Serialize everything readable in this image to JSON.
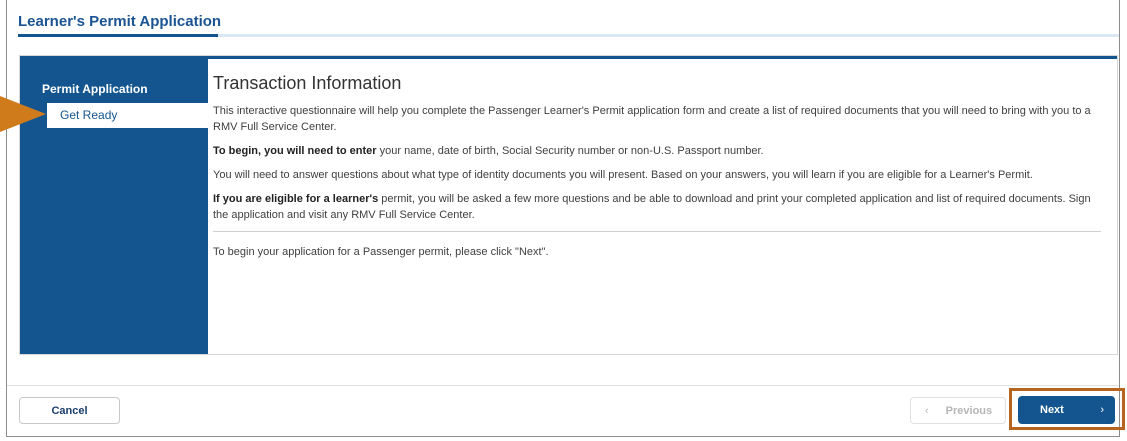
{
  "app": {
    "title": "Learner's Permit Application"
  },
  "sidebar": {
    "heading": "Permit Application",
    "items": [
      {
        "label": "Get Ready",
        "active": true
      }
    ]
  },
  "main": {
    "heading": "Transaction Information",
    "p1": "This interactive questionnaire will help you complete the Passenger Learner's Permit application form and create a list of required documents that you will need to bring with you to a RMV Full Service Center.",
    "p2_bold": "To begin, you will need to enter",
    "p2_rest": " your name, date of birth, Social Security number or non-U.S. Passport number.",
    "p3": "You will need to answer questions about what type of identity documents you will present. Based on your answers, you will learn if you are eligible for a Learner's Permit.",
    "p4_bold": "If you are eligible for a learner's",
    "p4_rest": " permit, you will be asked a few more questions and be able to download and print your completed application and list of required documents. Sign the application and visit any RMV Full Service Center.",
    "p5": "To begin your application for a Passenger permit, please click \"Next\"."
  },
  "footer": {
    "cancel_label": "Cancel",
    "previous_label": "Previous",
    "next_label": "Next",
    "previous_icon": "chevron-left-icon",
    "next_icon": "chevron-right-icon"
  },
  "colors": {
    "brand_blue": "#14558f",
    "highlight_orange": "#b5651d",
    "pointer_orange": "#cf7a1b"
  }
}
